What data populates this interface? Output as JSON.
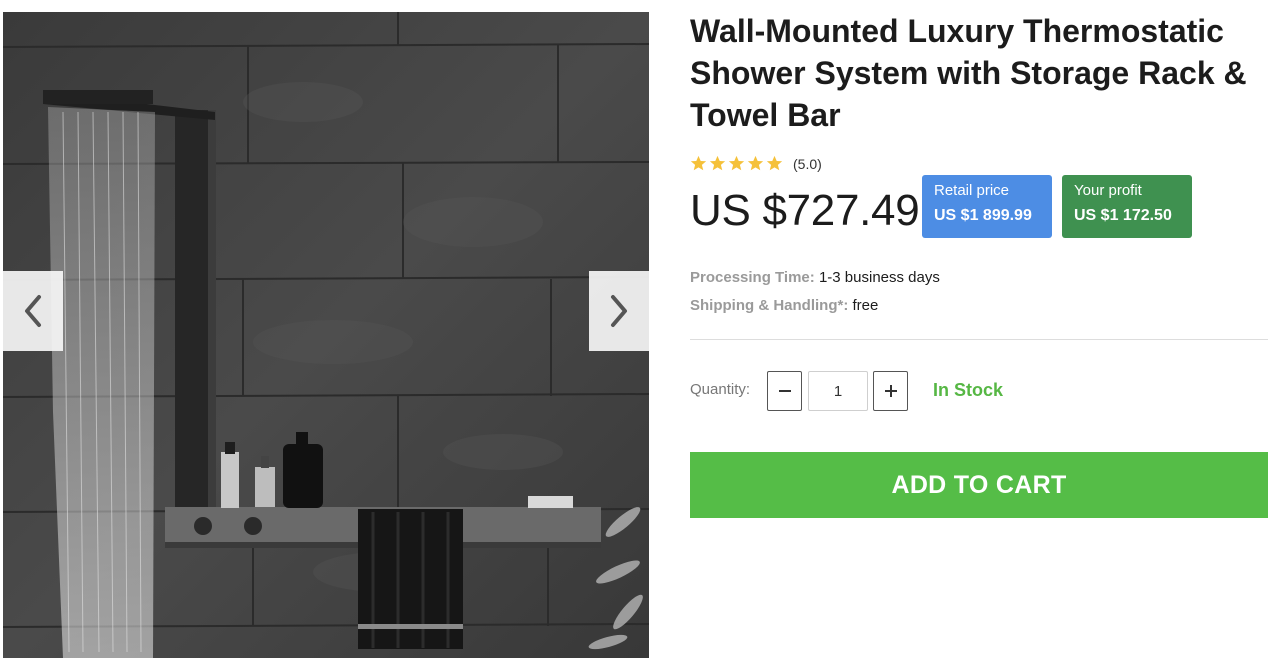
{
  "product": {
    "title": "Wall-Mounted Luxury Thermostatic Shower System with Storage Rack & Towel Bar",
    "rating_value": 5.0,
    "rating_text": "(5.0)",
    "stars_filled": 5,
    "stars_total": 5,
    "price": "US $727.49"
  },
  "badges": {
    "retail_label": "Retail price",
    "retail_value": "US $1 899.99",
    "profit_label": "Your profit",
    "profit_value": "US $1 172.50"
  },
  "details": {
    "processing_label": "Processing Time:",
    "processing_value": "1-3 business days",
    "shipping_label": "Shipping & Handling*:",
    "shipping_value": "free"
  },
  "quantity": {
    "label": "Quantity:",
    "value": "1",
    "stock_status": "In Stock"
  },
  "cart": {
    "button_label": "ADD TO CART"
  },
  "gallery": {
    "prev_icon": "chevron-left-icon",
    "next_icon": "chevron-right-icon"
  },
  "colors": {
    "star": "#f5c13a",
    "retail_badge": "#4d8de4",
    "profit_badge": "#3f9150",
    "stock_green": "#56b744",
    "cart_green": "#55bd47"
  }
}
